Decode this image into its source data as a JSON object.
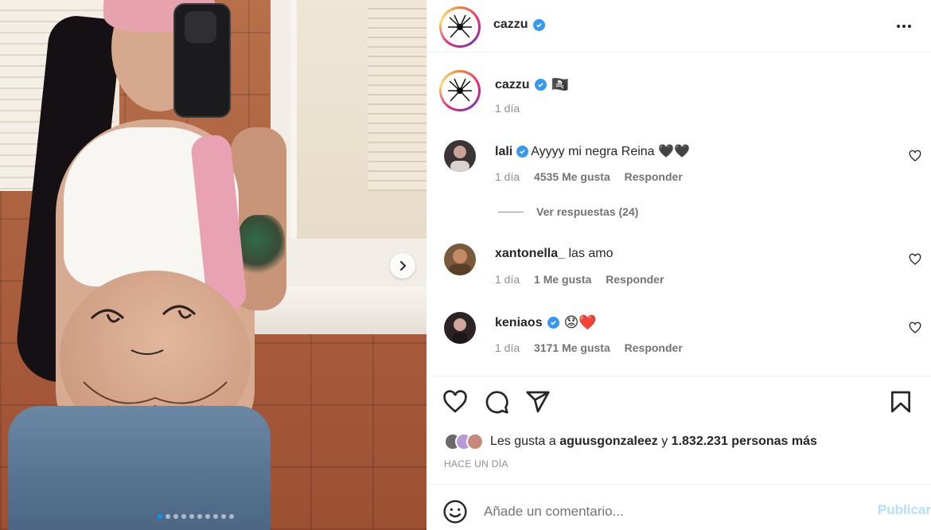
{
  "post": {
    "slides_total": 10,
    "slide_active_index": 0
  },
  "header": {
    "username": "cazzu"
  },
  "caption": {
    "username": "cazzu",
    "flag_emoji": "🏴‍☠️",
    "time": "1 día"
  },
  "comments": [
    {
      "username": "lali",
      "verified": true,
      "text": "Ayyyy mi negra Reina 🖤🖤",
      "time": "1 día",
      "likes": "4535 Me gusta",
      "reply_label": "Responder",
      "avatar_color": "#3a3436"
    },
    {
      "username": "xantonella_",
      "verified": false,
      "text": "las amo",
      "time": "1 día",
      "likes": "1 Me gusta",
      "reply_label": "Responder",
      "avatar_color": "#7a5a3c"
    },
    {
      "username": "keniaos",
      "verified": true,
      "text": "😟❤️",
      "time": "1 día",
      "likes": "3171 Me gusta",
      "reply_label": "Responder",
      "avatar_color": "#2b2326"
    }
  ],
  "view_replies_label": "Ver respuestas (24)",
  "likes": {
    "prefix": "Les gusta a",
    "user": "aguusgonzaleez",
    "middle": "y",
    "count": "1.832.231 personas más"
  },
  "time_ago": "HACE UN DÍA",
  "comment_box": {
    "placeholder": "Añade un comentario...",
    "publish_label": "Publicar"
  },
  "colors": {
    "verified": "#3897f0",
    "publish_disabled": "#b2dffc",
    "active_dot": "#0095f6"
  },
  "icons": {
    "like": "heart-icon",
    "comment": "comment-icon",
    "share": "send-icon",
    "save": "bookmark-icon",
    "emoji": "emoji-icon",
    "more": "more-icon",
    "next": "chevron-right-icon"
  }
}
